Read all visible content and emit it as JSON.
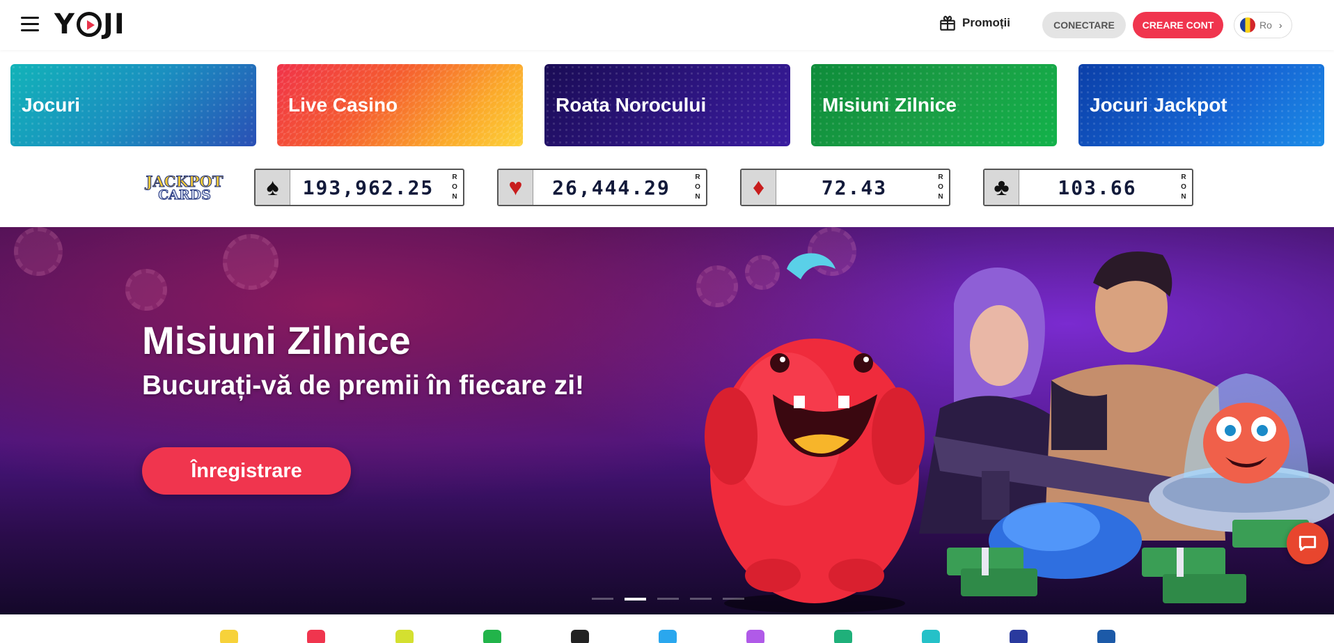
{
  "header": {
    "logo_text": "YOJI",
    "promo_label": "Promoții",
    "login_label": "CONECTARE",
    "register_label": "CREARE CONT",
    "lang_label": "Ro",
    "icons": [
      "menu-icon",
      "gift-icon",
      "flag-icon",
      "chevron-right-icon"
    ],
    "accent": "#f0354e"
  },
  "categories": [
    {
      "label": "Jocuri"
    },
    {
      "label": "Live Casino"
    },
    {
      "label": "Roata Norocului"
    },
    {
      "label": "Misiuni Zilnice"
    },
    {
      "label": "Jocuri Jackpot"
    }
  ],
  "jackpot": {
    "logo_line1": "JACKPOT",
    "logo_line2": "CARDS",
    "currency": [
      "R",
      "O",
      "N"
    ],
    "items": [
      {
        "suit": "♠",
        "amount": "193,962.25"
      },
      {
        "suit": "♥",
        "amount": "26,444.29"
      },
      {
        "suit": "♦",
        "amount": "72.43"
      },
      {
        "suit": "♣",
        "amount": "103.66"
      }
    ]
  },
  "hero": {
    "title": "Misiuni Zilnice",
    "subtitle": "Bucurați-vă de premii în fiecare zi!",
    "cta_label": "Înregistrare",
    "slides_total": 5,
    "active_slide": 2
  },
  "chat": {
    "icon": "chat-icon"
  },
  "providers_strip": {
    "count": 11
  }
}
